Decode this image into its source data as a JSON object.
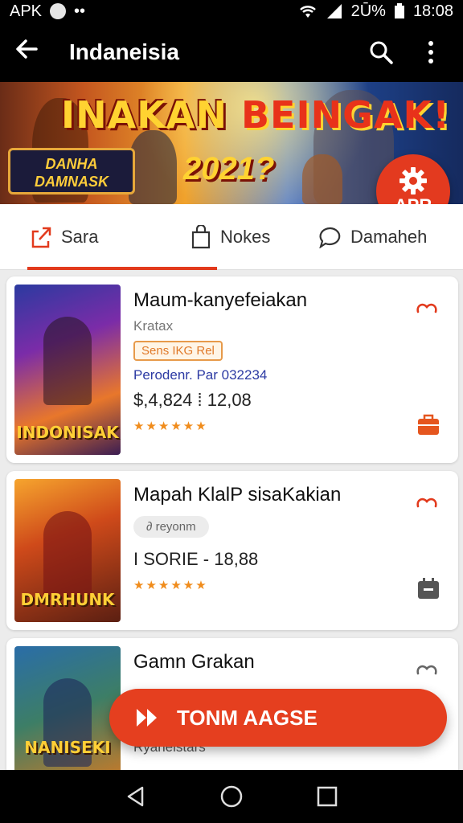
{
  "status_bar": {
    "carrier": "APK",
    "dots": "••",
    "battery": "2Ū%",
    "time": "18:08"
  },
  "app_bar": {
    "title": "Indaneisia"
  },
  "banner": {
    "headline_part1": "INAKAN ",
    "headline_part2": "BEINGAK!",
    "year": "2021?",
    "logo_line1": "DANHA",
    "logo_line2": "DAMNASK"
  },
  "fab": {
    "label": "APR"
  },
  "tabs": [
    {
      "label": "Sara"
    },
    {
      "label": "Nokes"
    },
    {
      "label": "Damaheh"
    }
  ],
  "games": [
    {
      "title": "Maum-kanyefeiakan",
      "subtitle": "Kratax",
      "tag": "Sens IKG Rel",
      "publisher": "Perodenr. Par 032234",
      "price": "$,4,824 ⁞ 12,08",
      "stars": "★★★★★★",
      "cover_title": "INDONISAK"
    },
    {
      "title": "Mapah KlalP sisaKakian",
      "tag": "∂ reyonm",
      "price": "I SORIE - 18,88",
      "stars": "★★★★★★",
      "cover_title": "DMRHUNK"
    },
    {
      "title": "Gamn Grakan",
      "subtitle": "Ryanelstars",
      "cover_title": "NANISEKI"
    }
  ],
  "cta": {
    "label": "TONM AAGSE"
  },
  "colors": {
    "accent": "#e53f1f",
    "bar": "#000000",
    "star": "#f08c1c"
  }
}
